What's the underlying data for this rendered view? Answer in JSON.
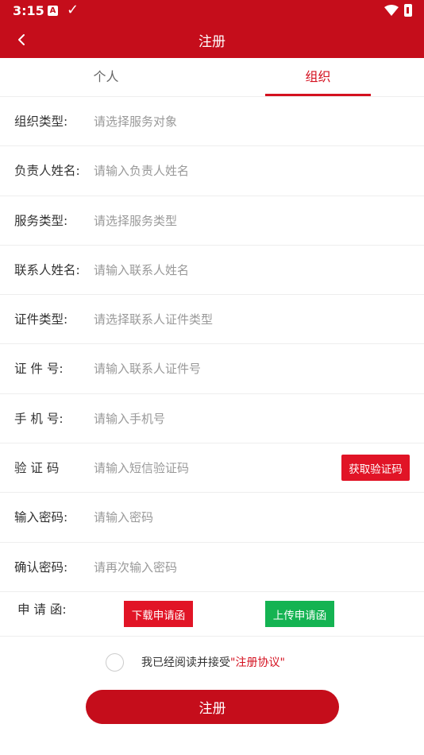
{
  "status_bar": {
    "time": "3:15",
    "a_icon": "A"
  },
  "header": {
    "title": "注册"
  },
  "tabs": [
    {
      "label": "个人",
      "active": false
    },
    {
      "label": "组织",
      "active": true
    }
  ],
  "form": {
    "rows": [
      {
        "label": "组织类型:",
        "placeholder": "请选择服务对象"
      },
      {
        "label": "负责人姓名:",
        "placeholder": "请输入负责人姓名"
      },
      {
        "label": "服务类型:",
        "placeholder": "请选择服务类型"
      },
      {
        "label": "联系人姓名:",
        "placeholder": "请输入联系人姓名"
      },
      {
        "label": "证件类型:",
        "placeholder": "请选择联系人证件类型"
      },
      {
        "label": "证 件 号:",
        "placeholder": "请输入联系人证件号"
      },
      {
        "label": "手 机 号:",
        "placeholder": "请输入手机号"
      },
      {
        "label": "验 证 码",
        "placeholder": "请输入短信验证码"
      },
      {
        "label": "输入密码:",
        "placeholder": "请输入密码"
      },
      {
        "label": "确认密码:",
        "placeholder": "请再次输入密码"
      }
    ],
    "sms_button": "获取验证码"
  },
  "application_letter": {
    "label": "申 请 函:",
    "download_label": "下载申请函",
    "upload_label": "上传申请函"
  },
  "agreement": {
    "text": "我已经阅读并接受",
    "link": "\"注册协议\"",
    "checked": false
  },
  "submit_label": "注册",
  "colors": {
    "primary": "#c50d1b",
    "accent": "#e11426",
    "green": "#14b352"
  }
}
